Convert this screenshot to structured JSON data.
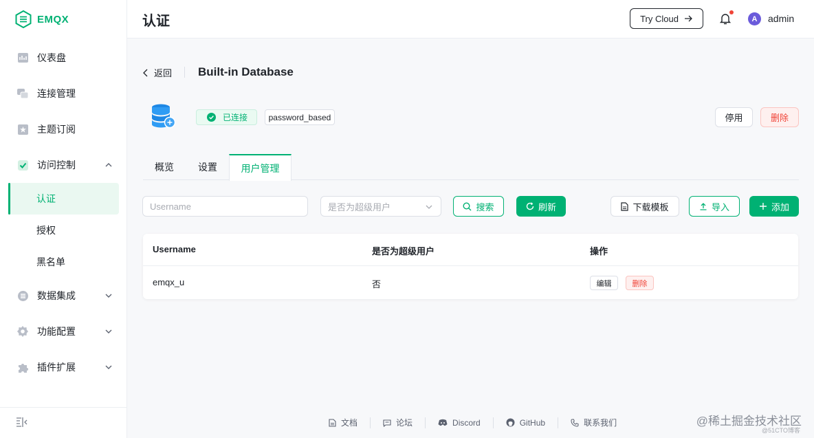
{
  "app": {
    "brand": "EMQX"
  },
  "sidebar": {
    "items": [
      {
        "label": "仪表盘",
        "icon": "dashboard-icon"
      },
      {
        "label": "连接管理",
        "icon": "connections-icon"
      },
      {
        "label": "主题订阅",
        "icon": "subscriptions-icon"
      },
      {
        "label": "访问控制",
        "icon": "access-control-icon",
        "expanded": true
      },
      {
        "label": "数据集成",
        "icon": "data-integration-icon"
      },
      {
        "label": "功能配置",
        "icon": "settings-icon"
      },
      {
        "label": "插件扩展",
        "icon": "plugins-icon"
      }
    ],
    "sub_items": [
      {
        "label": "认证",
        "active": true
      },
      {
        "label": "授权",
        "active": false
      },
      {
        "label": "黑名单",
        "active": false
      }
    ]
  },
  "header": {
    "title": "认证",
    "try_cloud_label": "Try Cloud",
    "avatar_letter": "A",
    "user": "admin"
  },
  "detail": {
    "back_label": "返回",
    "title": "Built-in Database",
    "status_tag": "已连接",
    "mechanism_tag": "password_based",
    "disable_label": "停用",
    "delete_label": "删除"
  },
  "tabs": [
    {
      "label": "概览",
      "active": false
    },
    {
      "label": "设置",
      "active": false
    },
    {
      "label": "用户管理",
      "active": true
    }
  ],
  "toolbar": {
    "username_placeholder": "Username",
    "superuser_placeholder": "是否为超级用户",
    "search_label": "搜索",
    "refresh_label": "刷新",
    "download_label": "下载模板",
    "import_label": "导入",
    "add_label": "添加"
  },
  "table": {
    "headers": [
      "Username",
      "是否为超级用户",
      "操作"
    ],
    "rows": [
      {
        "username": "emqx_u",
        "superuser": "否",
        "edit_label": "编辑",
        "delete_label": "删除"
      }
    ]
  },
  "footer": {
    "links": [
      "文档",
      "论坛",
      "Discord",
      "GitHub",
      "联系我们"
    ]
  },
  "watermark": {
    "main": "@稀土掘金技术社区",
    "sub": "@51CTO博客"
  },
  "colors": {
    "accent": "#00b173",
    "danger": "#f04438"
  }
}
